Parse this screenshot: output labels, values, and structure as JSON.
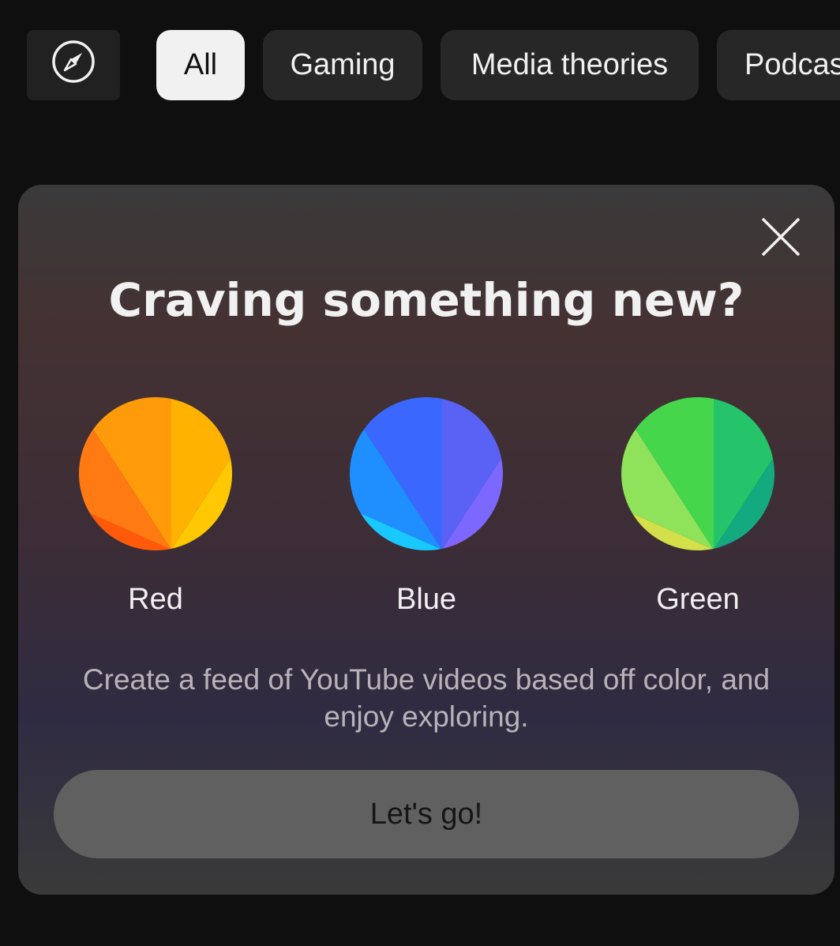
{
  "chips": {
    "explore_icon": "compass-icon",
    "items": [
      {
        "label": "All",
        "selected": true
      },
      {
        "label": "Gaming"
      },
      {
        "label": "Media theories"
      },
      {
        "label": "Podcasts"
      }
    ]
  },
  "promo": {
    "close_icon": "close-icon",
    "title": "Craving something new?",
    "options": [
      {
        "label": "Red",
        "colors": [
          "#ff5a0a",
          "#ff7a12",
          "#ff9a0a",
          "#ffb200",
          "#ffc800",
          "#ffd500"
        ]
      },
      {
        "label": "Blue",
        "colors": [
          "#19c8ff",
          "#1f8fff",
          "#3a68ff",
          "#5a62f5",
          "#7d68ff",
          "#b45cff"
        ]
      },
      {
        "label": "Green",
        "colors": [
          "#d4e04a",
          "#8ee35a",
          "#46d64c",
          "#25c46a",
          "#14aa80",
          "#3a7aa8"
        ]
      }
    ],
    "description": "Create a feed of YouTube videos based off color, and enjoy exploring.",
    "button_label": "Let's go!"
  },
  "colors": {
    "background": "#0f0f0f",
    "chip": "#272727",
    "chip_selected": "#f1f1f1",
    "button": "#606060"
  }
}
